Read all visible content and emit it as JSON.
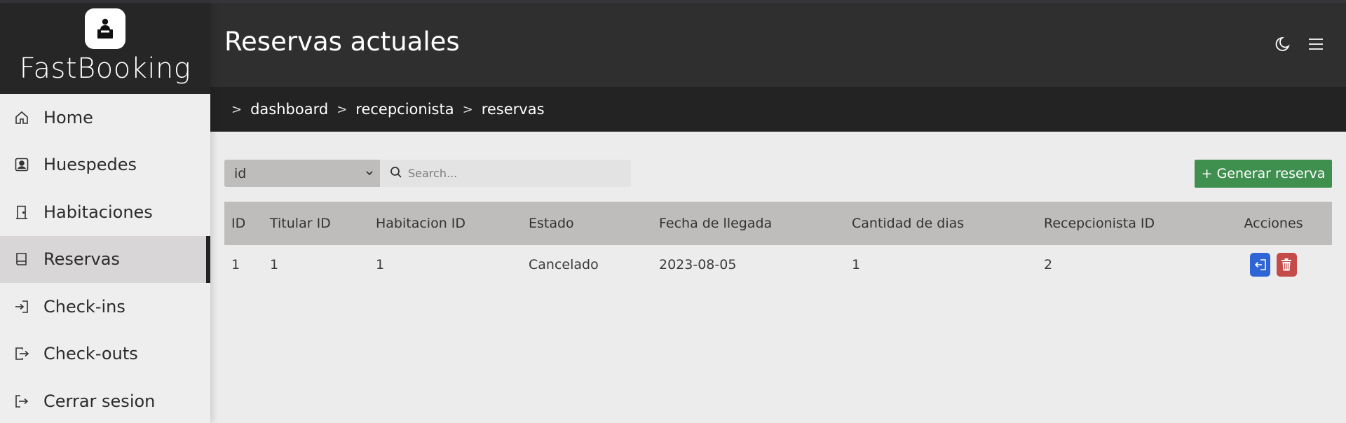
{
  "app": {
    "name": "FastBooking"
  },
  "header": {
    "title": "Reservas actuales",
    "theme_icon": "moon-icon",
    "menu_icon": "hamburger-menu-icon"
  },
  "breadcrumb": [
    "dashboard",
    "recepcionista",
    "reservas"
  ],
  "sidebar": {
    "items": [
      {
        "label": "Home",
        "icon": "home-icon"
      },
      {
        "label": "Huespedes",
        "icon": "user-card-icon"
      },
      {
        "label": "Habitaciones",
        "icon": "door-icon"
      },
      {
        "label": "Reservas",
        "icon": "book-icon",
        "active": true
      },
      {
        "label": "Check-ins",
        "icon": "sign-in-icon"
      },
      {
        "label": "Check-outs",
        "icon": "sign-out-icon"
      },
      {
        "label": "Cerrar sesion",
        "icon": "logout-icon"
      }
    ]
  },
  "controls": {
    "filter_value": "id",
    "search_placeholder": "Search...",
    "add_button": "+ Generar reserva"
  },
  "table": {
    "columns": [
      "ID",
      "Titular ID",
      "Habitacion ID",
      "Estado",
      "Fecha de llegada",
      "Cantidad de dias",
      "Recepcionista ID",
      "Acciones"
    ],
    "rows": [
      [
        "1",
        "1",
        "1",
        "Cancelado",
        "2023-08-05",
        "1",
        "2"
      ]
    ]
  },
  "colors": {
    "header_bg": "#2f2f2f",
    "breadcrumb_bg": "#232323",
    "sidebar_active_bg": "#d8d6d6",
    "add_button_bg": "#3f8f4f",
    "action_blue": "#2f64d6",
    "action_red": "#c54b4b"
  }
}
